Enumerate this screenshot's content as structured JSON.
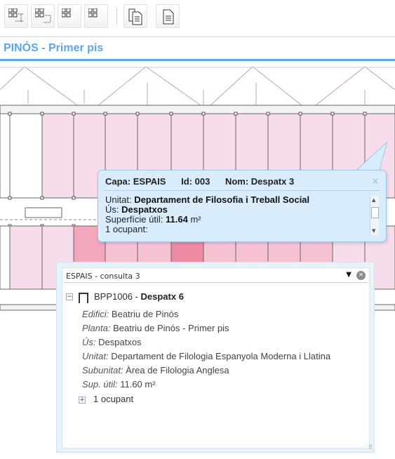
{
  "toolbar": {
    "buttons": [
      {
        "icon": "grid-select-icon"
      },
      {
        "icon": "grid-select-alt-icon"
      },
      {
        "icon": "grid-icon"
      },
      {
        "icon": "grid-list-icon"
      },
      {
        "icon": "documents-icon"
      },
      {
        "icon": "document-icon"
      }
    ]
  },
  "header": {
    "title": "PINÓS - Primer pis"
  },
  "map": {
    "room_fill": "#f7dcec",
    "highlight_fill": "#f2a7bc",
    "selected_fill": "#ef8aa5",
    "wall_color": "#666666"
  },
  "tooltip": {
    "capa_label": "Capa:",
    "capa_value": "ESPAIS",
    "id_label": "Id:",
    "id_value": "003",
    "nom_label": "Nom:",
    "nom_value": "Despatx 3",
    "close": "×",
    "lines": [
      {
        "label": "Unitat: ",
        "value": "Departament de Filosofia i Treball Social"
      },
      {
        "label": "Ús: ",
        "value": "Despatxos"
      },
      {
        "label": "Superfície útil: ",
        "value": "11.64",
        "unit": " m²"
      },
      {
        "label": "1 ocupant:",
        "value": ""
      }
    ]
  },
  "panel": {
    "title": "ESPAIS - consulta 3",
    "close": "×",
    "record": {
      "toggle": "−",
      "code": "BPP1006",
      "separator": " - ",
      "name": "Despatx 6",
      "fields": [
        {
          "label": "Edifici:",
          "value": "Beatriu de Pinós"
        },
        {
          "label": "Planta:",
          "value": "Beatriu de Pinós - Primer pis"
        },
        {
          "label": "Ús:",
          "value": "Despatxos"
        },
        {
          "label": "Unitat:",
          "value": "Departament de Filologia Espanyola Moderna i Llatina"
        },
        {
          "label": "Subunitat:",
          "value": "Àrea de Filologia Anglesa"
        },
        {
          "label": "Sup. útil:",
          "value": "11.60 m²"
        }
      ],
      "occupants_toggle": "+",
      "occupants": "1 ocupant"
    }
  }
}
